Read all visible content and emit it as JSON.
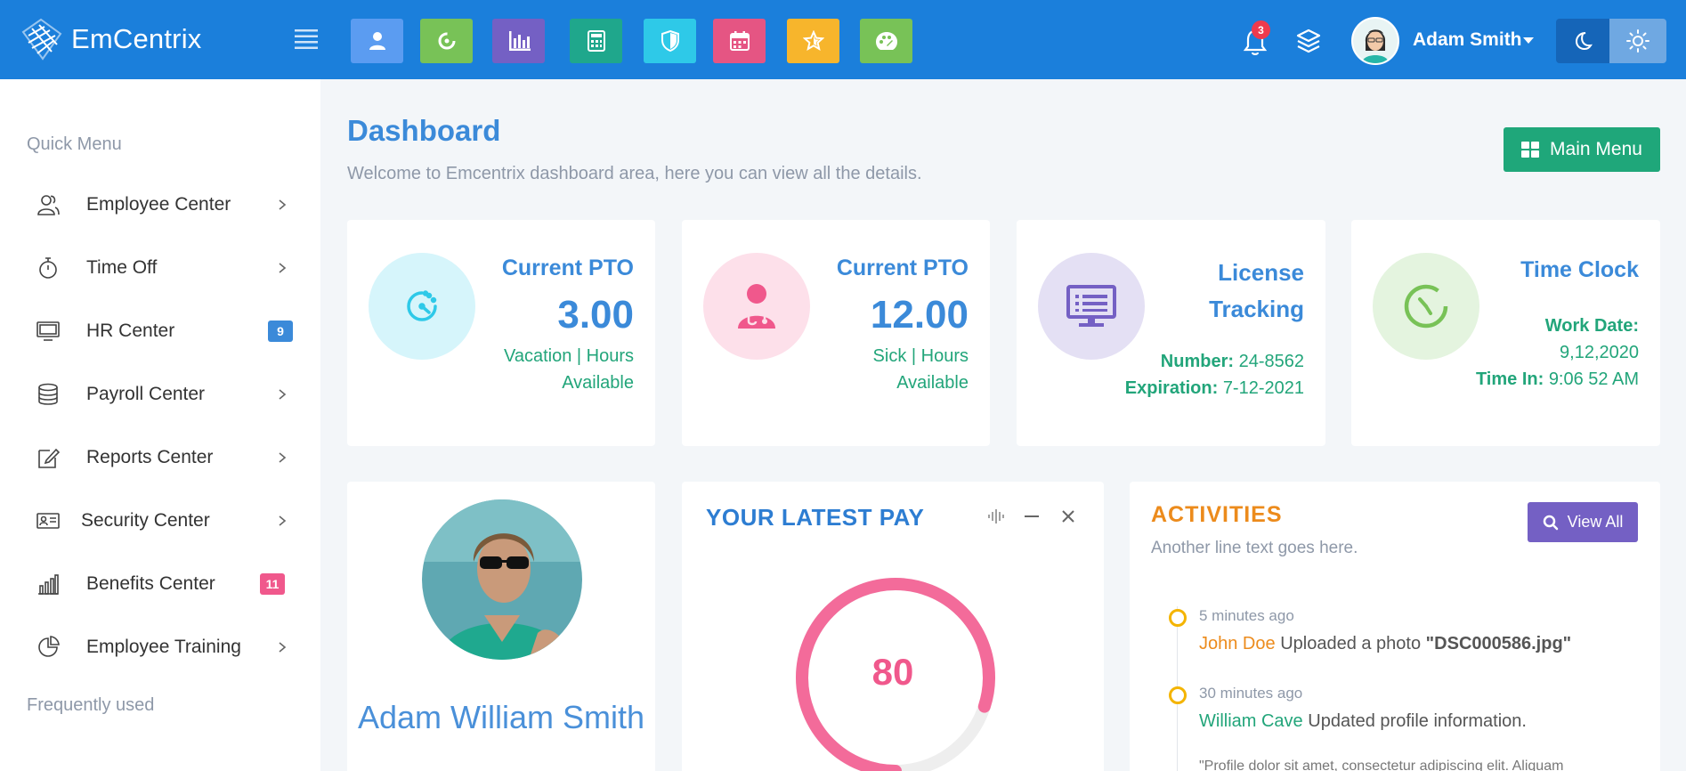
{
  "app": {
    "logo_text": "EmCentrix"
  },
  "topbar": {
    "quick_buttons": [
      {
        "name": "user-quick-button",
        "icon": "user-icon",
        "color": "#5b9cf1"
      },
      {
        "name": "refresh-quick-button",
        "icon": "refresh-icon",
        "color": "#78c257"
      },
      {
        "name": "chart-quick-button",
        "icon": "bar-chart-icon",
        "color": "#7460c4"
      },
      {
        "name": "calculator-quick-button",
        "icon": "calculator-icon",
        "color": "#1fa78c"
      },
      {
        "name": "shield-quick-button",
        "icon": "shield-icon",
        "color": "#2ec9e8"
      },
      {
        "name": "calendar-quick-button",
        "icon": "calendar-icon",
        "color": "#e55583"
      },
      {
        "name": "star-quick-button",
        "icon": "star-icon",
        "color": "#f7b52c"
      },
      {
        "name": "dashboard-quick-button",
        "icon": "palette-icon",
        "color": "#78c257"
      }
    ],
    "notification_count": "3",
    "user_name": "Adam Smith"
  },
  "sidebar": {
    "quick_menu_label": "Quick Menu",
    "frequently_used_label": "Frequently used",
    "items": [
      {
        "label": "Employee Center",
        "icon": "users-icon",
        "badge": null
      },
      {
        "label": "Time Off",
        "icon": "timer-icon",
        "badge": null
      },
      {
        "label": "HR Center",
        "icon": "monitor-icon",
        "badge": "9",
        "badge_color": "#3b8ad9"
      },
      {
        "label": "Payroll Center",
        "icon": "database-icon",
        "badge": null
      },
      {
        "label": "Reports Center",
        "icon": "edit-icon",
        "badge": null
      },
      {
        "label": "Security Center",
        "icon": "id-card-icon",
        "badge": null
      },
      {
        "label": "Benefits Center",
        "icon": "bar-chart-icon",
        "badge": "11",
        "badge_color": "#f0588c"
      },
      {
        "label": "Employee Training",
        "icon": "pie-chart-icon",
        "badge": null
      }
    ]
  },
  "main": {
    "title": "Dashboard",
    "subtitle": "Welcome to Emcentrix dashboard area, here you can view all the details.",
    "main_menu_label": "Main Menu",
    "stats": [
      {
        "title": "Current PTO",
        "value": "3.00",
        "desc": "Vacation | Hours Available",
        "icon": "clock-icon",
        "bg": "#d6f5fb",
        "fg": "#2ec9e8"
      },
      {
        "title": "Current PTO",
        "value": "12.00",
        "desc": "Sick | Hours Available",
        "icon": "doctor-icon",
        "bg": "#fde0ea",
        "fg": "#f0588c"
      }
    ],
    "license": {
      "title": "License Tracking",
      "number_label": "Number:",
      "number": "24-8562",
      "expiration_label": "Expiration:",
      "expiration": "7-12-2021",
      "icon": "monitor-list-icon"
    },
    "time_clock": {
      "title": "Time Clock",
      "work_date_label": "Work Date:",
      "work_date": "9,12,2020",
      "time_in_label": "Time In:",
      "time_in": "9:06 52 AM",
      "icon": "clock-icon"
    },
    "profile": {
      "name": "Adam William Smith"
    },
    "latest_pay": {
      "title": "YOUR LATEST PAY",
      "value": "80",
      "percent": 80
    },
    "activities": {
      "title": "ACTIVITIES",
      "subtitle": "Another line text goes here.",
      "view_all_label": "View All",
      "items": [
        {
          "time": "5 minutes ago",
          "actor": "John Doe",
          "actor_color": "#ec8b1c",
          "action": "Uploaded a photo",
          "object": "\"DSC000586.jpg\""
        },
        {
          "time": "30 minutes ago",
          "actor": "William Cave",
          "actor_color": "#22a57a",
          "action": "Updated profile information.",
          "object": ""
        }
      ],
      "quote": "\"Profile dolor sit amet, consectetur adipiscing elit. Aliquam"
    }
  }
}
